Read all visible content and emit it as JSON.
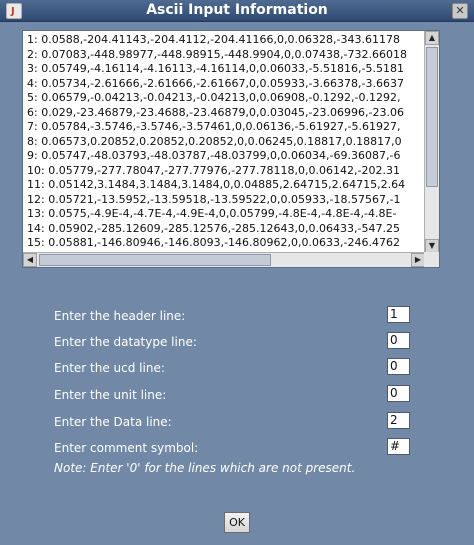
{
  "window": {
    "title": "Ascii Input Information",
    "close_glyph": "✕",
    "app_icon": "java-cup-icon",
    "app_icon_glyph": "J"
  },
  "data_preview": {
    "lines": [
      "1:  0.0588,-204.41143,-204.4112,-204.41166,0,0.06328,-343.61178",
      "2:  0.07083,-448.98977,-448.98915,-448.9904,0,0.07438,-732.66018",
      "3:  0.05749,-4.16114,-4.16113,-4.16114,0,0.06033,-5.51816,-5.5181",
      "4:  0.05734,-2.61666,-2.61666,-2.61667,0,0.05933,-3.66378,-3.6637",
      "5:  0.06579,-0.04213,-0.04213,-0.04213,0,0.06908,-0.1292,-0.1292,",
      "6:  0.029,-23.46879,-23.4688,-23.46879,0,0.03045,-23.06996,-23.06",
      "7:  0.05784,-3.5746,-3.5746,-3.57461,0,0.06136,-5.61927,-5.61927,",
      "8:  0.06573,0.20852,0.20852,0.20852,0,0.06245,0.18817,0.18817,0",
      "9:  0.05747,-48.03793,-48.03787,-48.03799,0,0.06034,-69.36087,-6",
      "10:  0.05779,-277.78047,-277.77976,-277.78118,0,0.06142,-202.31",
      "11:  0.05142,3.1484,3.1484,3.1484,0,0.04885,2.64715,2.64715,2.64",
      "12:  0.05721,-13.5952,-13.59518,-13.59522,0,0.05933,-18.57567,-1",
      "13:  0.0575,-4.9E-4,-4.7E-4,-4.9E-4,0,0.05799,-4.8E-4,-4.8E-4,-4.8E-",
      "14:  0.05902,-285.12609,-285.12576,-285.12643,0,0.06433,-547.25",
      "15:  0.05881,-146.80946,-146.8093,-146.80962,0,0.0633,-246.4762"
    ]
  },
  "scrollbars": {
    "up_arrow": "▲",
    "down_arrow": "▼",
    "left_arrow": "◀",
    "right_arrow": "▶"
  },
  "form": {
    "header_label": "Enter the header line:",
    "header_value": "1",
    "datatype_label": "Enter the datatype line:",
    "datatype_value": "0",
    "ucd_label": "Enter the ucd line:",
    "ucd_value": "0",
    "unit_label": "Enter the unit line:",
    "unit_value": "0",
    "data_label": "Enter the Data line:",
    "data_value": "2",
    "comment_label": "Enter comment symbol:",
    "comment_value": "#",
    "note": "Note: Enter '0' for the lines which are not present."
  },
  "ok_button": "OK"
}
